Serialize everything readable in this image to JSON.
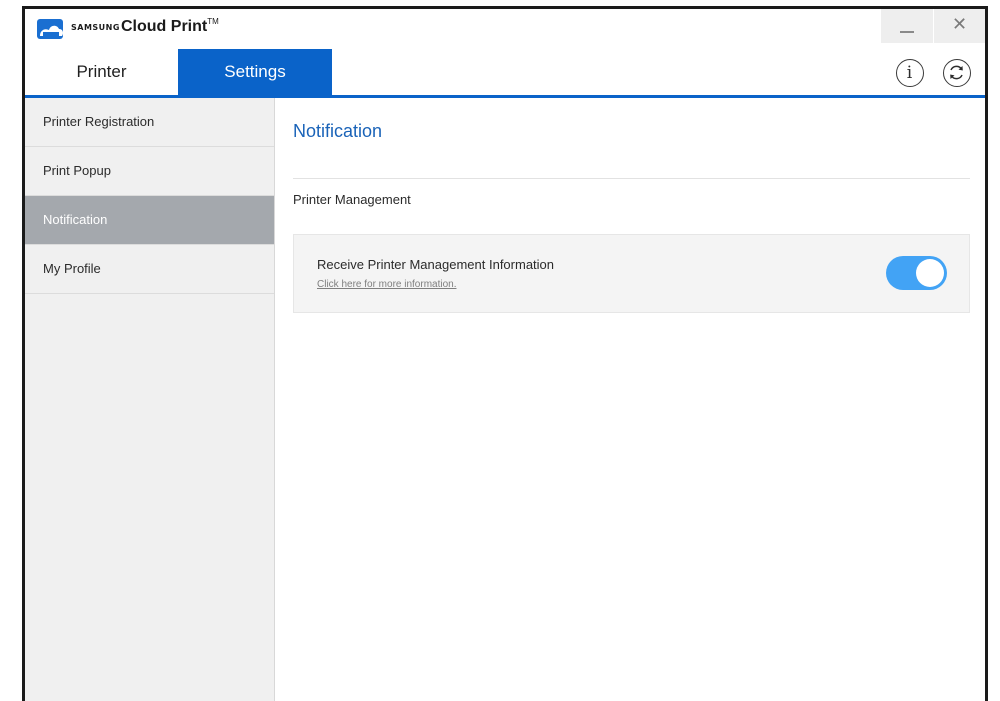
{
  "app": {
    "brand_small": "SAMSUNG",
    "brand_name": "Cloud Print",
    "brand_tm": "TM",
    "accent_color": "#0a63c9",
    "toggle_color": "#42a3f5"
  },
  "window_controls": {
    "minimize_icon": "minimize-icon",
    "close_glyph": "✕"
  },
  "tabs": [
    {
      "label": "Printer",
      "active": false
    },
    {
      "label": "Settings",
      "active": true
    }
  ],
  "toolbar": {
    "info_glyph": "i",
    "info_icon": "info-icon",
    "refresh_icon": "refresh-icon"
  },
  "sidebar": {
    "items": [
      {
        "label": "Printer Registration",
        "active": false
      },
      {
        "label": "Print Popup",
        "active": false
      },
      {
        "label": "Notification",
        "active": true
      },
      {
        "label": "My Profile",
        "active": false
      }
    ]
  },
  "main": {
    "title": "Notification",
    "section": "Printer Management",
    "setting": {
      "name": "Receive Printer Management Information",
      "link": "Click here for more information.",
      "enabled": true
    }
  }
}
